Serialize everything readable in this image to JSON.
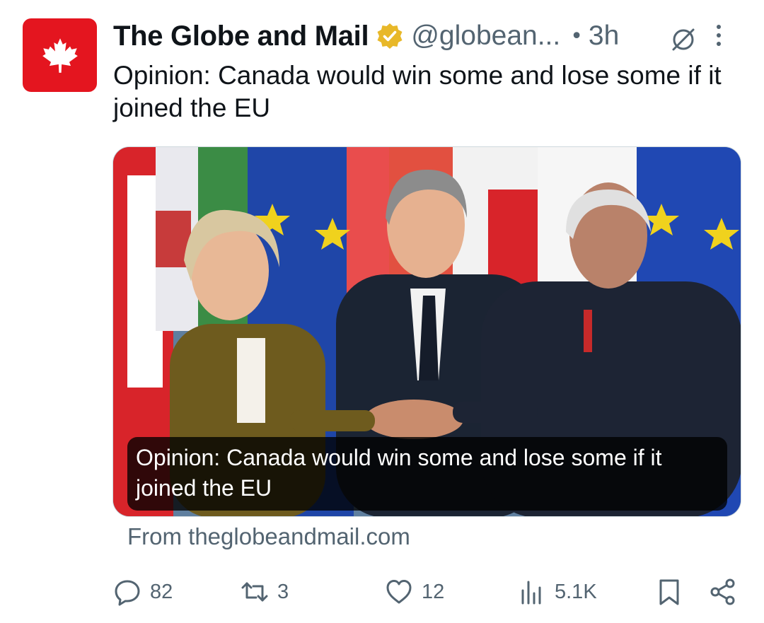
{
  "tweet": {
    "author_name": "The Globe and Mail",
    "handle": "@globean...",
    "separator": "•",
    "time": "3h",
    "text": "Opinion: Canada would win some and lose some if it joined the EU"
  },
  "card": {
    "caption": "Opinion: Canada would win some and lose some if it joined the EU",
    "source": "From theglobeandmail.com"
  },
  "actions": {
    "replies": "82",
    "reposts": "3",
    "likes": "12",
    "views": "5.1K"
  },
  "colors": {
    "brand_red": "#e4151f",
    "verified_gold": "#e8b829",
    "text_primary": "#0f1419",
    "text_secondary": "#536471"
  },
  "icons": [
    "maple-leaf-icon",
    "verified-badge-icon",
    "grok-icon",
    "more-icon",
    "reply-icon",
    "repost-icon",
    "like-icon",
    "views-icon",
    "bookmark-icon",
    "share-icon"
  ]
}
